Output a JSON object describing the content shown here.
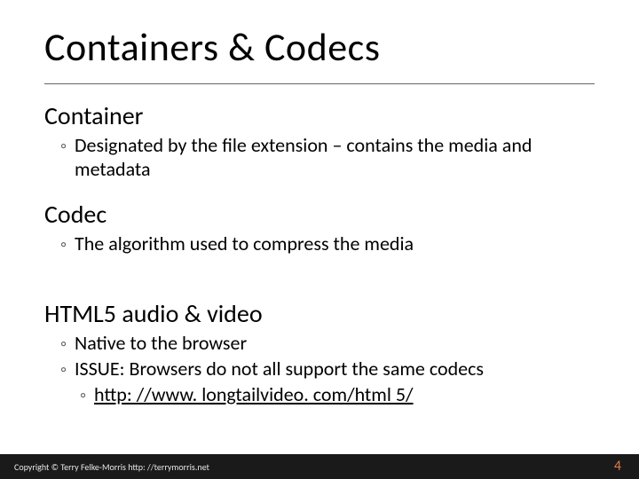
{
  "title": "Containers & Codecs",
  "sections": [
    {
      "heading": "Container",
      "bullets": [
        {
          "text": "Designated by the file extension – contains the media and metadata"
        }
      ]
    },
    {
      "heading": "Codec",
      "bullets": [
        {
          "text": "The algorithm used to compress the media"
        }
      ]
    },
    {
      "heading": "HTML5 audio & video",
      "bullets": [
        {
          "text": "Native to the browser"
        },
        {
          "text": "ISSUE: Browsers do not all support the same codecs"
        }
      ],
      "subbullets": [
        {
          "text": "http: //www. longtailvideo. com/html 5/",
          "link": true
        }
      ]
    }
  ],
  "bullet_marker": "◦",
  "copyright": "Copyright © Terry Felke-Morris http: //terrymorris.net",
  "page_number": "4"
}
